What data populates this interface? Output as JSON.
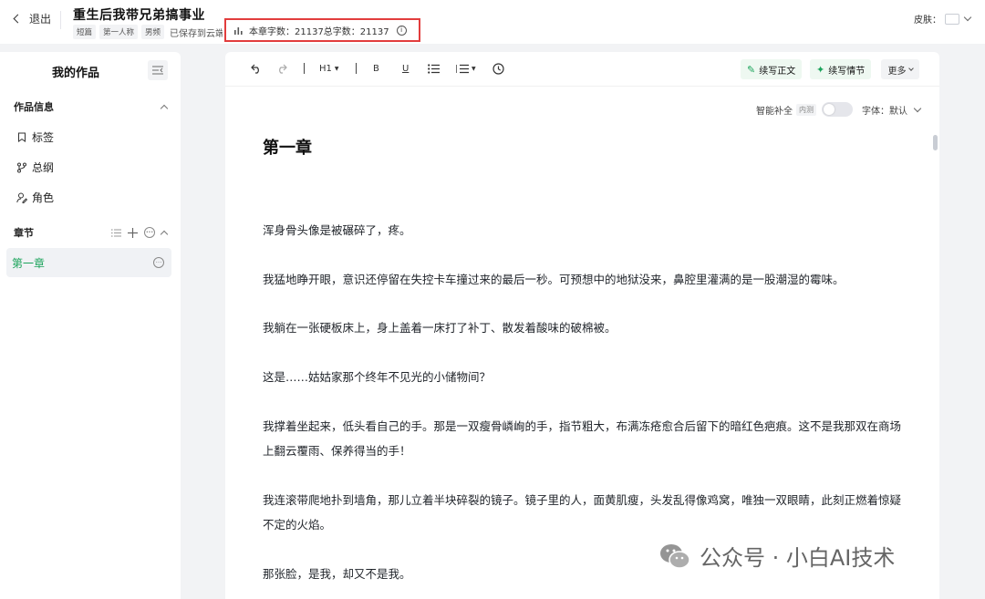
{
  "header": {
    "back_label": "退出",
    "book_title": "重生后我带兄弟搞事业",
    "tags": [
      "短篇",
      "第一人称",
      "男频"
    ],
    "save_status": "已保存到云端",
    "word_count": "本章字数：21137总字数：21137",
    "skin_label": "皮肤："
  },
  "sidebar": {
    "title": "我的作品",
    "info_section": "作品信息",
    "items": [
      {
        "label": "标签",
        "icon": "bookmark-icon"
      },
      {
        "label": "总纲",
        "icon": "outline-icon"
      },
      {
        "label": "角色",
        "icon": "character-icon"
      }
    ],
    "chapters_section": "章节",
    "chapters": [
      {
        "label": "第一章"
      }
    ]
  },
  "toolbar": {
    "heading": "H1",
    "bold": "B",
    "underline": "U",
    "continue_text": "续写正文",
    "continue_plot": "续写情节",
    "more": "更多"
  },
  "editor": {
    "smart_complete": "智能补全",
    "beta": "内测",
    "font_label": "字体：默认",
    "chapter_title": "第一章",
    "paragraphs": [
      "浑身骨头像是被碾碎了，疼。",
      "我猛地睁开眼，意识还停留在失控卡车撞过来的最后一秒。可预想中的地狱没来，鼻腔里灌满的是一股潮湿的霉味。",
      "我躺在一张硬板床上，身上盖着一床打了补丁、散发着酸味的破棉被。",
      "这是……姑姑家那个终年不见光的小储物间？",
      "我撑着坐起来，低头看自己的手。那是一双瘦骨嶙峋的手，指节粗大，布满冻疮愈合后留下的暗红色疤痕。这不是我那双在商场上翻云覆雨、保养得当的手！",
      "我连滚带爬地扑到墙角，那儿立着半块碎裂的镜子。镜子里的人，面黄肌瘦，头发乱得像鸡窝，唯独一双眼睛，此刻正燃着惊疑不定的火焰。",
      "那张脸，是我，却又不是我。"
    ]
  },
  "watermark": "公众号 · 小白AI技术",
  "colors": {
    "accent_green": "#1aa35a",
    "highlight_red": "#e23d3d",
    "page_bg": "#f2f3f5"
  }
}
